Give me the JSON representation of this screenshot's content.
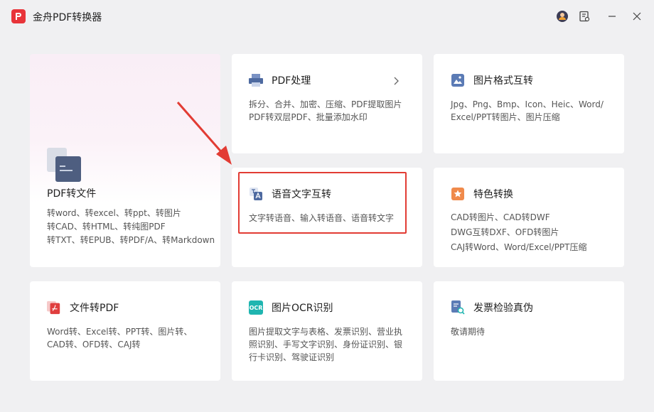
{
  "app": {
    "title": "金舟PDF转换器"
  },
  "cards": {
    "pdf_to_file": {
      "title": "PDF转文件",
      "lines": [
        "转word、转excel、转ppt、转图片",
        "转CAD、转HTML、转纯图PDF",
        "转TXT、转EPUB、转PDF/A、转Markdown"
      ]
    },
    "pdf_process": {
      "title": "PDF处理",
      "lines": [
        "拆分、合并、加密、压缩、PDF提取图片",
        "PDF转双层PDF、批量添加水印"
      ]
    },
    "image_format": {
      "title": "图片格式互转",
      "lines": [
        "Jpg、Png、Bmp、Icon、Heic、Word/",
        "Excel/PPT转图片、图片压缩"
      ]
    },
    "speech_text": {
      "title": "语音文字互转",
      "lines": [
        "文字转语音、输入转语音、语音转文字"
      ]
    },
    "special": {
      "title": "特色转换",
      "lines": [
        "CAD转图片、CAD转DWF",
        "DWG互转DXF、OFD转图片",
        "CAJ转Word、Word/Excel/PPT压缩"
      ]
    },
    "file_to_pdf": {
      "title": "文件转PDF",
      "lines": [
        "Word转、Excel转、PPT转、图片转、",
        "CAD转、OFD转、CAJ转"
      ]
    },
    "ocr": {
      "title": "图片OCR识别",
      "lines": [
        "图片提取文字与表格、发票识别、营业执",
        "照识别、手写文字识别、身份证识别、银",
        "行卡识别、驾驶证识别"
      ]
    },
    "invoice": {
      "title": "发票检验真伪",
      "lines": [
        "敬请期待"
      ]
    }
  },
  "icons": {
    "ocr_label": "OCR"
  },
  "colors": {
    "accent_red": "#e23c34",
    "logo_red": "#e8343a",
    "blue_icon": "#5b7bb5",
    "orange_icon": "#f08a4b",
    "teal_icon": "#1fb5b0"
  }
}
